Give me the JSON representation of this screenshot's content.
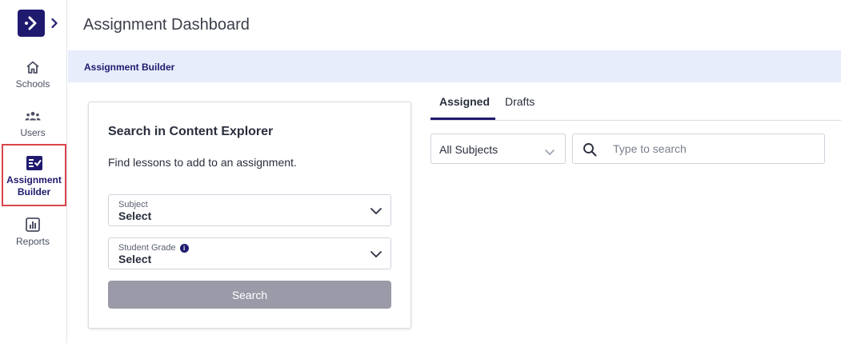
{
  "sidebar": {
    "items": [
      {
        "label": "Schools"
      },
      {
        "label": "Users"
      },
      {
        "label": "Assignment Builder"
      },
      {
        "label": "Reports"
      }
    ]
  },
  "header": {
    "title": "Assignment Dashboard",
    "banner": "Assignment Builder"
  },
  "card": {
    "title": "Search in Content Explorer",
    "description": "Find lessons to add to an assignment.",
    "subject": {
      "label": "Subject",
      "value": "Select"
    },
    "grade": {
      "label": "Student Grade",
      "value": "Select"
    },
    "search_label": "Search"
  },
  "tabs": [
    {
      "label": "Assigned",
      "active": true
    },
    {
      "label": "Drafts",
      "active": false
    }
  ],
  "filters": {
    "subjects_value": "All Subjects",
    "search_placeholder": "Type to search"
  },
  "colors": {
    "brand": "#1f1a6e",
    "banner_bg": "#e8edfc",
    "highlight_border": "#d9464b",
    "disabled_button": "#9a9aa8"
  }
}
